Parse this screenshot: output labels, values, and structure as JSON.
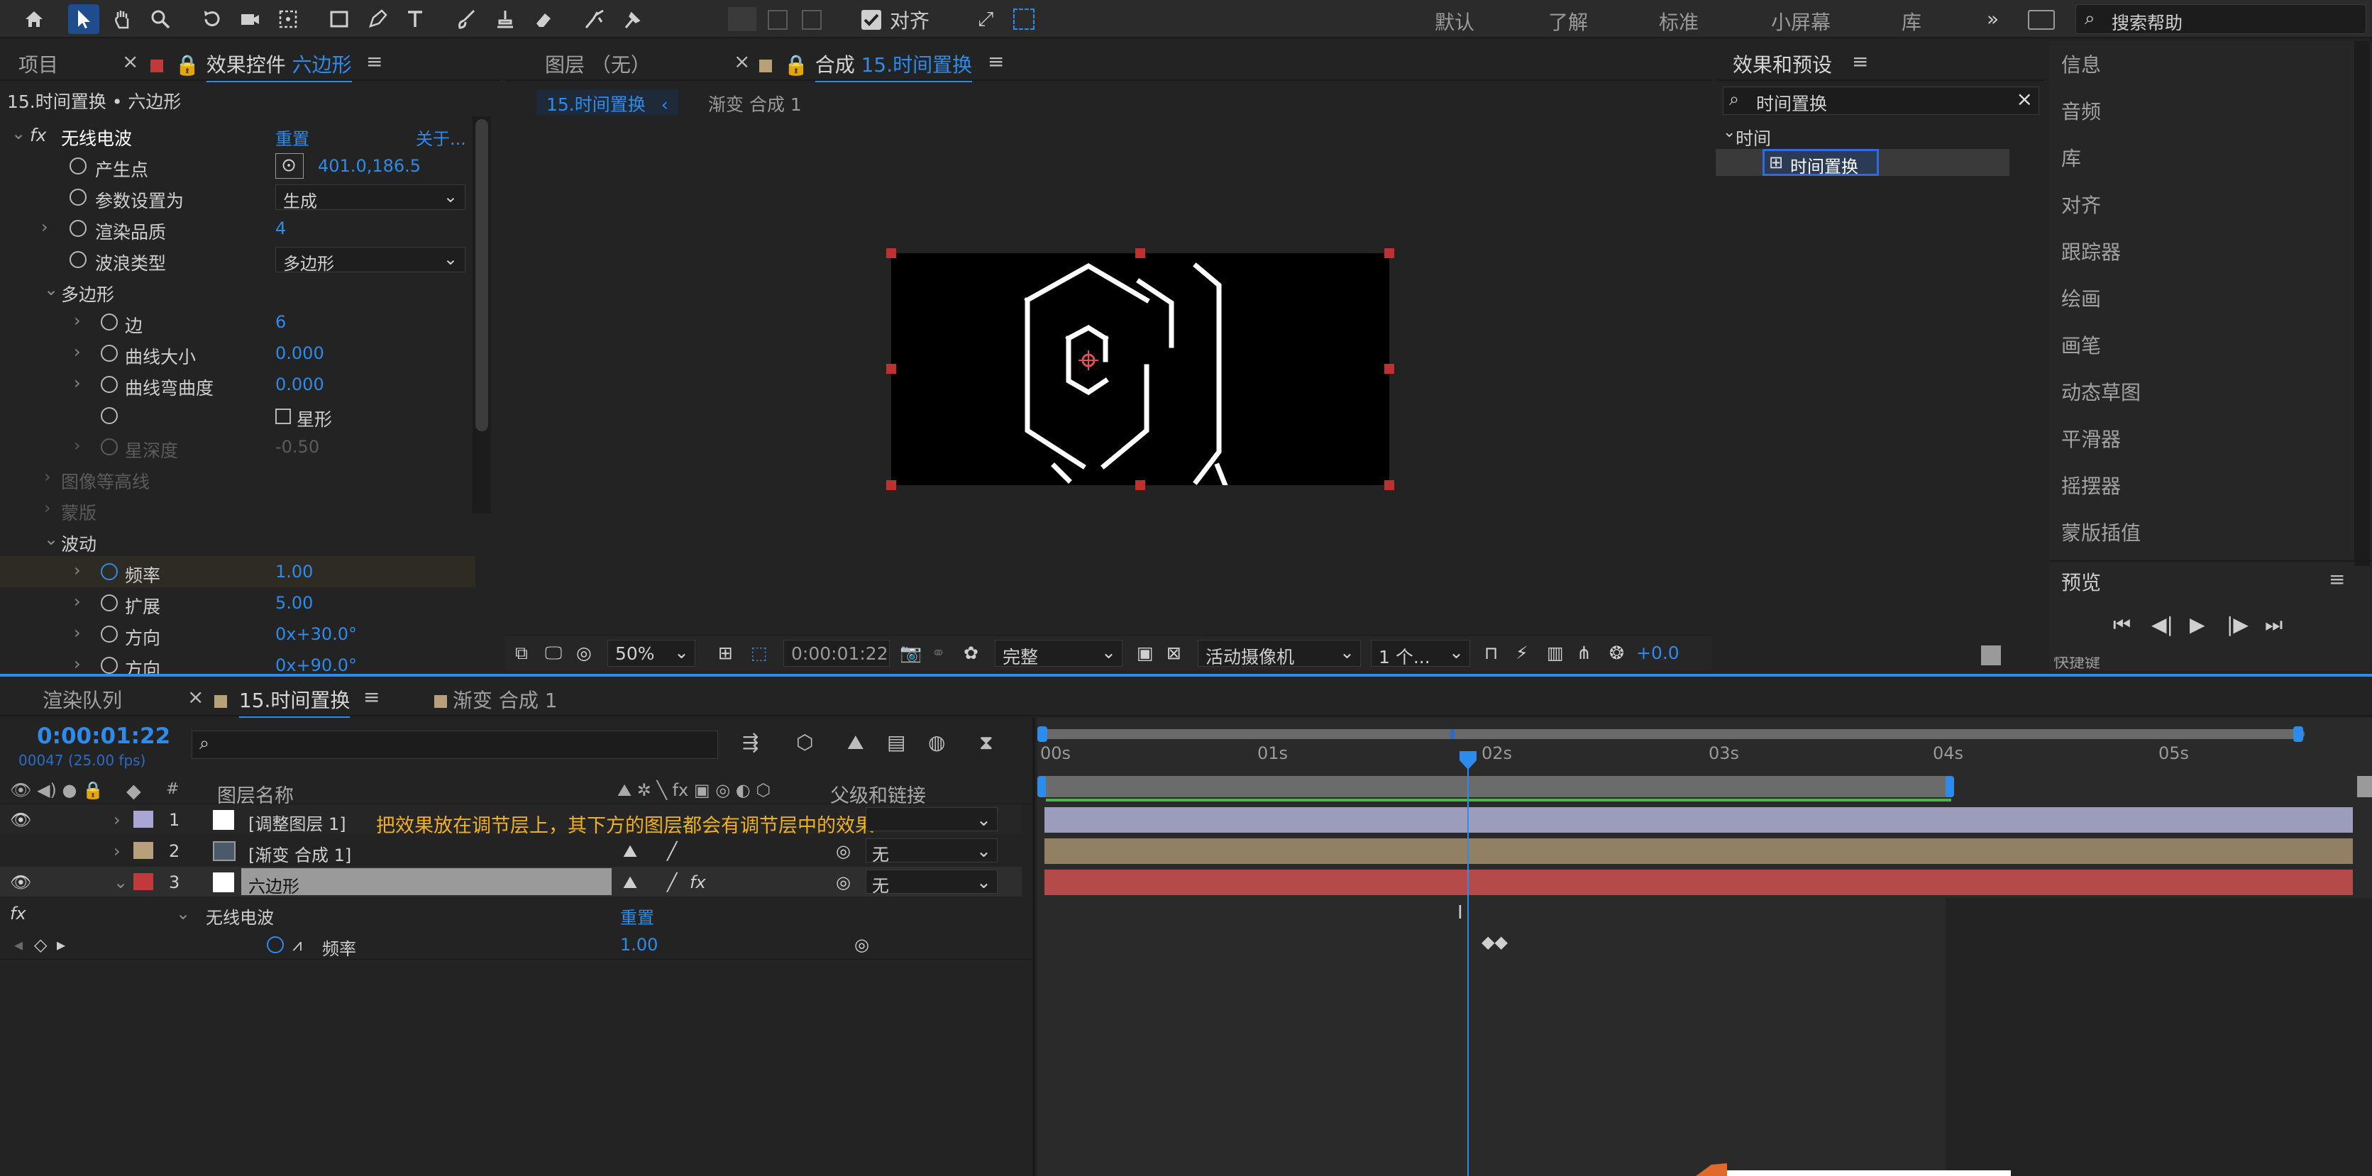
{
  "toolbar": {
    "align_label": "对齐",
    "workspaces": [
      "默认",
      "了解",
      "标准",
      "小屏幕",
      "库"
    ],
    "search_placeholder": "搜索帮助",
    "more": "»"
  },
  "left_panel": {
    "tab_project": "项目",
    "tab_effect_controls_prefix": "效果控件",
    "tab_effect_controls_layer": "六边形",
    "breadcrumb": "15.时间置换 • 六边形",
    "effect": {
      "name": "无线电波",
      "reset": "重置",
      "about": "关于...",
      "props": [
        {
          "label": "产生点",
          "value": "401.0,186.5"
        },
        {
          "label": "参数设置为",
          "value": "生成"
        },
        {
          "label": "渲染品质",
          "value": "4"
        },
        {
          "label": "波浪类型",
          "value": "多边形"
        },
        {
          "label": "多边形",
          "value": ""
        },
        {
          "label": "边",
          "value": "6"
        },
        {
          "label": "曲线大小",
          "value": "0.000"
        },
        {
          "label": "曲线弯曲度",
          "value": "0.000"
        },
        {
          "label": "",
          "value": "星形"
        },
        {
          "label": "星深度",
          "value": "-0.50"
        },
        {
          "label": "图像等高线",
          "value": ""
        },
        {
          "label": "蒙版",
          "value": ""
        },
        {
          "label": "波动",
          "value": ""
        },
        {
          "label": "频率",
          "value": "1.00"
        },
        {
          "label": "扩展",
          "value": "5.00"
        },
        {
          "label": "方向",
          "value": "0x+30.0°"
        },
        {
          "label": "方向",
          "value": "0x+90.0°"
        }
      ]
    }
  },
  "viewer": {
    "tab_layer": "图层 （无）",
    "tab_comp_prefix": "合成",
    "tab_comp_name": "15.时间置换",
    "nav_active": "15.时间置换",
    "nav_other": "渐变 合成 1",
    "zoom": "50%",
    "timecode": "0:00:01:22",
    "quality": "完整",
    "camera": "活动摄像机",
    "views": "1 个...",
    "exposure": "+0.0"
  },
  "effects_presets": {
    "title": "效果和预设",
    "search_value": "时间置换",
    "category": "时间",
    "result": "时间置换"
  },
  "right_list": [
    "信息",
    "音频",
    "库",
    "对齐",
    "跟踪器",
    "绘画",
    "画笔",
    "动态草图",
    "平滑器",
    "摇摆器",
    "蒙版插值"
  ],
  "preview": {
    "title": "预览",
    "shortcut": "快捷键"
  },
  "timeline": {
    "tab_render": "渲染队列",
    "tab_comp": "15.时间置换",
    "tab_other": "渐变 合成 1",
    "timecode": "0:00:01:22",
    "frames": "00047 (25.00 fps)",
    "col_layer_name": "图层名称",
    "col_parent": "父级和链接",
    "col_num": "#",
    "ruler": [
      "00s",
      "01s",
      "02s",
      "03s",
      "04s",
      "05s"
    ],
    "layers": [
      {
        "num": "1",
        "name": "[调整图层 1]",
        "parent": "",
        "label_color": "#a9a6d6"
      },
      {
        "num": "2",
        "name": "[渐变 合成 1]",
        "parent": "无",
        "label_color": "#b8a07a"
      },
      {
        "num": "3",
        "name": "六边形",
        "parent": "无",
        "label_color": "#c03a3a"
      }
    ],
    "annotation": "把效果放在调节层上，其下方的图层都会有调节层中的效果",
    "sub_effect": "无线电波",
    "sub_reset": "重置",
    "sub_prop": "频率",
    "sub_value": "1.00",
    "fx": "fx"
  }
}
